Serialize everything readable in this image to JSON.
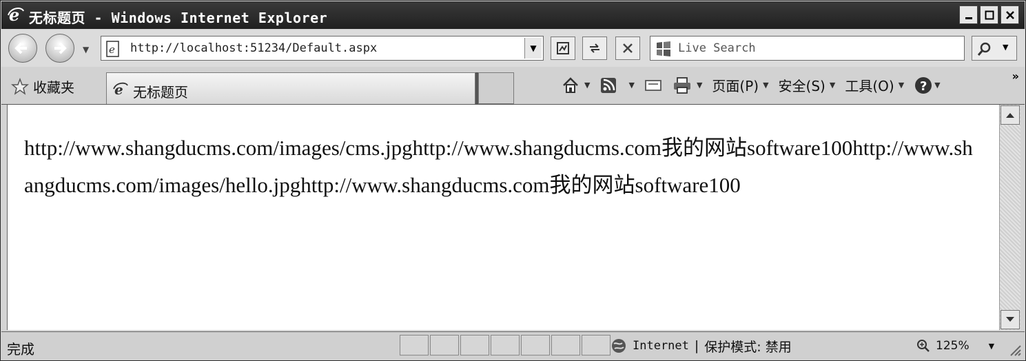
{
  "window": {
    "title": "无标题页 - Windows Internet Explorer",
    "controls": {
      "minimize": "_",
      "maximize": "□",
      "close": "✕"
    }
  },
  "navbar": {
    "address_url": "http://localhost:51234/Default.aspx",
    "search_placeholder": "Live Search"
  },
  "command_bar": {
    "favorites_label": "收藏夹",
    "tab_title": "无标题页",
    "page_menu": "页面(P)",
    "safety_menu": "安全(S)",
    "tools_menu": "工具(O)",
    "overflow": "»"
  },
  "content": {
    "text": "http://www.shangducms.com/images/cms.jpghttp://www.shangducms.com我的网站software100http://www.shangducms.com/images/hello.jpghttp://www.shangducms.com我的网站software100"
  },
  "statusbar": {
    "status": "完成",
    "zone_name": "Internet",
    "zone_separator": "|",
    "protected_mode": "保护模式: 禁用",
    "zoom": "125%"
  },
  "colors": {
    "titlebar": "#2a2a2a",
    "chrome": "#d4d4d4"
  }
}
